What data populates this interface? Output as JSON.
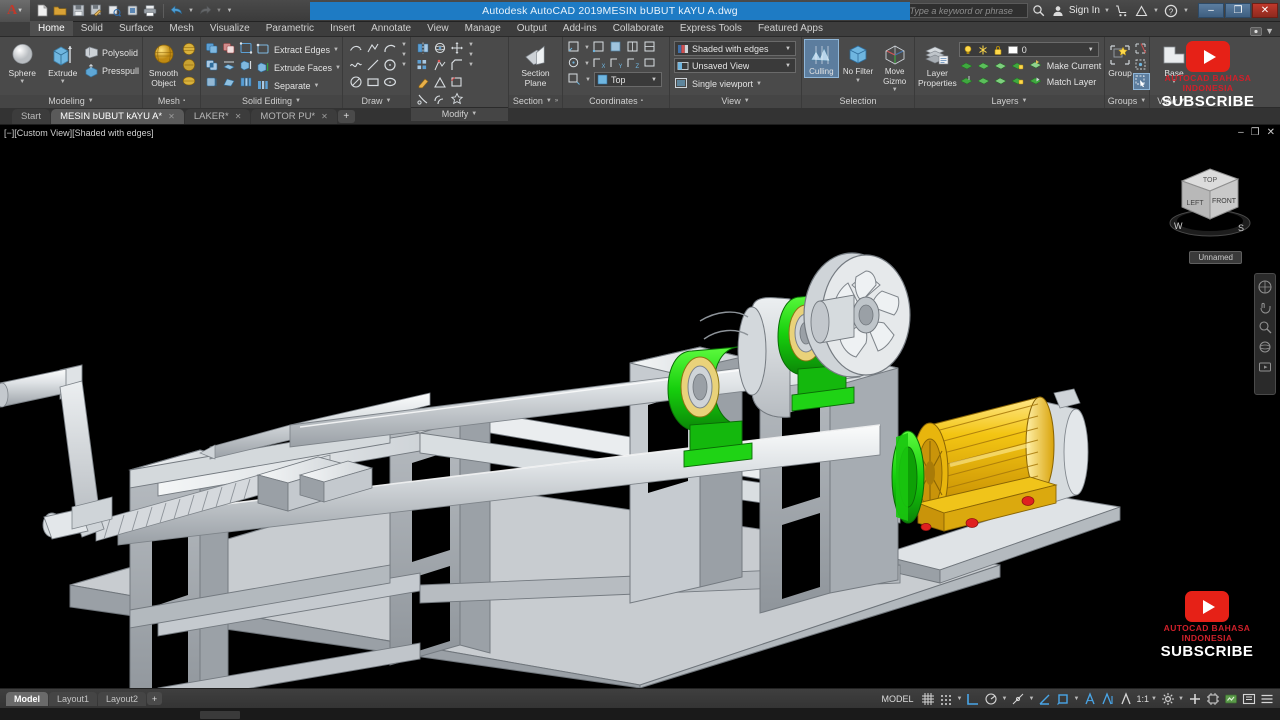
{
  "titlebar": {
    "app_logo": "A",
    "product": "Autodesk AutoCAD 2019",
    "document": "MESIN bUBUT kAYU A.dwg",
    "search_placeholder": "Type a keyword or phrase",
    "signin_label": "Sign In",
    "quick_access": [
      "new-icon",
      "open-icon",
      "save-icon",
      "save-as-icon",
      "plot-preview-icon",
      "plot-device-icon",
      "print-icon",
      "undo-icon",
      "redo-icon"
    ],
    "window_buttons": [
      "minimize",
      "restore",
      "close"
    ],
    "close_glyph": "✕",
    "restore_glyph": "❐",
    "minimize_glyph": "–",
    "accent_blue": "#1e7bc4",
    "close_red": "#c0392b"
  },
  "ribbon_tabs": [
    {
      "label": "Home",
      "active": true
    },
    {
      "label": "Solid",
      "active": false
    },
    {
      "label": "Surface",
      "active": false
    },
    {
      "label": "Mesh",
      "active": false
    },
    {
      "label": "Visualize",
      "active": false
    },
    {
      "label": "Parametric",
      "active": false
    },
    {
      "label": "Insert",
      "active": false
    },
    {
      "label": "Annotate",
      "active": false
    },
    {
      "label": "View",
      "active": false
    },
    {
      "label": "Manage",
      "active": false
    },
    {
      "label": "Output",
      "active": false
    },
    {
      "label": "Add-ins",
      "active": false
    },
    {
      "label": "Collaborate",
      "active": false
    },
    {
      "label": "Express Tools",
      "active": false
    },
    {
      "label": "Featured Apps",
      "active": false
    }
  ],
  "ribbon": {
    "modeling": {
      "title": "Modeling",
      "sphere_label": "Sphere",
      "extrude_label": "Extrude",
      "polysolid_label": "Polysolid",
      "presspull_label": "Presspull"
    },
    "mesh": {
      "title": "Mesh",
      "smooth_object_label": "Smooth\nObject",
      "smooth_object_line1": "Smooth",
      "smooth_object_line2": "Object"
    },
    "solid_editing": {
      "title": "Solid Editing",
      "extract_edges_label": "Extract Edges",
      "extrude_faces_label": "Extrude Faces",
      "separate_label": "Separate"
    },
    "draw": {
      "title": "Draw"
    },
    "modify": {
      "title": "Modify"
    },
    "section": {
      "title": "Section",
      "plane_line1": "Section",
      "plane_line2": "Plane"
    },
    "coordinates": {
      "title": "Coordinates",
      "ucs_value": "Top"
    },
    "view": {
      "title": "View",
      "visual_style": "Shaded with edges",
      "named_view": "Unsaved View",
      "viewport_config": "Single viewport"
    },
    "selection": {
      "title": "Selection",
      "culling_label": "Culling",
      "no_filter_label": "No Filter",
      "move_gizmo_line1": "Move",
      "move_gizmo_line2": "Gizmo"
    },
    "layers": {
      "title": "Layers",
      "layer_properties_line1": "Layer",
      "layer_properties_line2": "Properties",
      "current_layer": "0",
      "make_current_label": "Make Current",
      "match_layer_label": "Match Layer"
    },
    "groups": {
      "title": "Groups",
      "group_label": "Group"
    },
    "view_panel_right": {
      "title": "View",
      "base_label": "Base"
    }
  },
  "document_tabs": [
    {
      "label": "Start",
      "active": false,
      "closable": false
    },
    {
      "label": "MESIN bUBUT kAYU A*",
      "active": true,
      "closable": true
    },
    {
      "label": "LAKER*",
      "active": false,
      "closable": true
    },
    {
      "label": "MOTOR PU*",
      "active": false,
      "closable": true
    }
  ],
  "document_tab_add": "+",
  "viewport": {
    "label": "[−][Custom View][Shaded with edges]",
    "background": "#000000",
    "window_buttons": [
      "–",
      "❐",
      "✕"
    ],
    "viewcube": {
      "top_face": "TOP",
      "left_face": "LEFT",
      "front_face": "FRONT",
      "compass_w": "W",
      "compass_s": "S",
      "named_view": "Unnamed"
    },
    "model": {
      "name": "wood lathe machine 3D assembly",
      "parts": [
        "frame",
        "bed-rails",
        "crank-handle",
        "threaded-screw",
        "tailstock-spindle",
        "pillow-block-bearings",
        "headstock-spindle",
        "pulley-wheel",
        "electric-motor",
        "motor-base-rail"
      ],
      "colors": {
        "steel": "#c9cdd1",
        "steel_light": "#e4e7ea",
        "steel_dark": "#8f959b",
        "bearing_green": "#18c80f",
        "bearing_green_dark": "#0e8a09",
        "motor_gold": "#e8b10c",
        "motor_gold_light": "#fbd64a",
        "motor_gold_dark": "#b5860a",
        "bolt_red": "#e02020"
      }
    },
    "watermark_top": {
      "channel": "AUTOCAD BAHASA INDONESIA",
      "cta": "SUBSCRIBE",
      "play_color": "#e62117"
    },
    "watermark_bottom": {
      "channel": "AUTOCAD BAHASA INDONESIA",
      "cta": "SUBSCRIBE",
      "play_color": "#e62117"
    }
  },
  "statusbar": {
    "layout_tabs": [
      {
        "label": "Model",
        "active": true
      },
      {
        "label": "Layout1",
        "active": false
      },
      {
        "label": "Layout2",
        "active": false
      }
    ],
    "layout_add": "+",
    "space_label": "MODEL",
    "scale_value": "1:1",
    "icons": [
      "grid-display-icon",
      "snap-mode-icon",
      "ortho-mode-icon",
      "polar-tracking-icon",
      "object-snap-tracking-icon",
      "ucs-icon",
      "annotation-visibility-icon",
      "isolate-objects-icon",
      "hardware-acceleration-icon",
      "clean-screen-icon",
      "customization-icon"
    ]
  }
}
